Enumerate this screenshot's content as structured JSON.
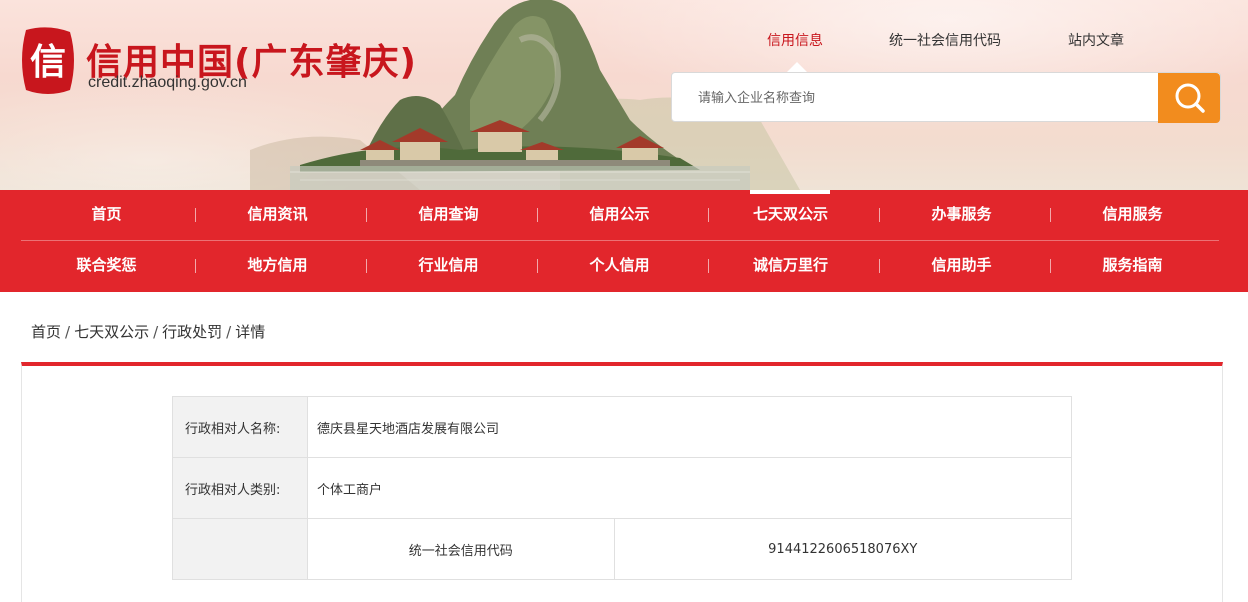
{
  "header": {
    "site_title": "信用中国(广东肇庆)",
    "site_url": "credit.zhaoqing.gov.cn",
    "seal_char": "信",
    "top_links": [
      {
        "label": "信用信息",
        "active": true
      },
      {
        "label": "统一社会信用代码",
        "active": false
      },
      {
        "label": "站内文章",
        "active": false
      }
    ],
    "search": {
      "placeholder": "请输入企业名称查询",
      "icon": "search-icon"
    }
  },
  "nav": {
    "row1": [
      "首页",
      "信用资讯",
      "信用查询",
      "信用公示",
      "七天双公示",
      "办事服务",
      "信用服务"
    ],
    "row2": [
      "联合奖惩",
      "地方信用",
      "行业信用",
      "个人信用",
      "诚信万里行",
      "信用助手",
      "服务指南"
    ],
    "active": "七天双公示"
  },
  "breadcrumb": [
    "首页",
    "七天双公示",
    "行政处罚",
    "详情"
  ],
  "detail": {
    "rows": [
      {
        "label": "行政相对人名称:",
        "value": "德庆县星天地酒店发展有限公司"
      },
      {
        "label": "行政相对人类别:",
        "value": "个体工商户"
      }
    ],
    "sub": {
      "label": "统一社会信用代码",
      "value": "914412260651807 6XY"
    }
  },
  "colors": {
    "brand_red": "#e2262c",
    "search_orange": "#f28c1e",
    "title_red": "#c8161d"
  }
}
